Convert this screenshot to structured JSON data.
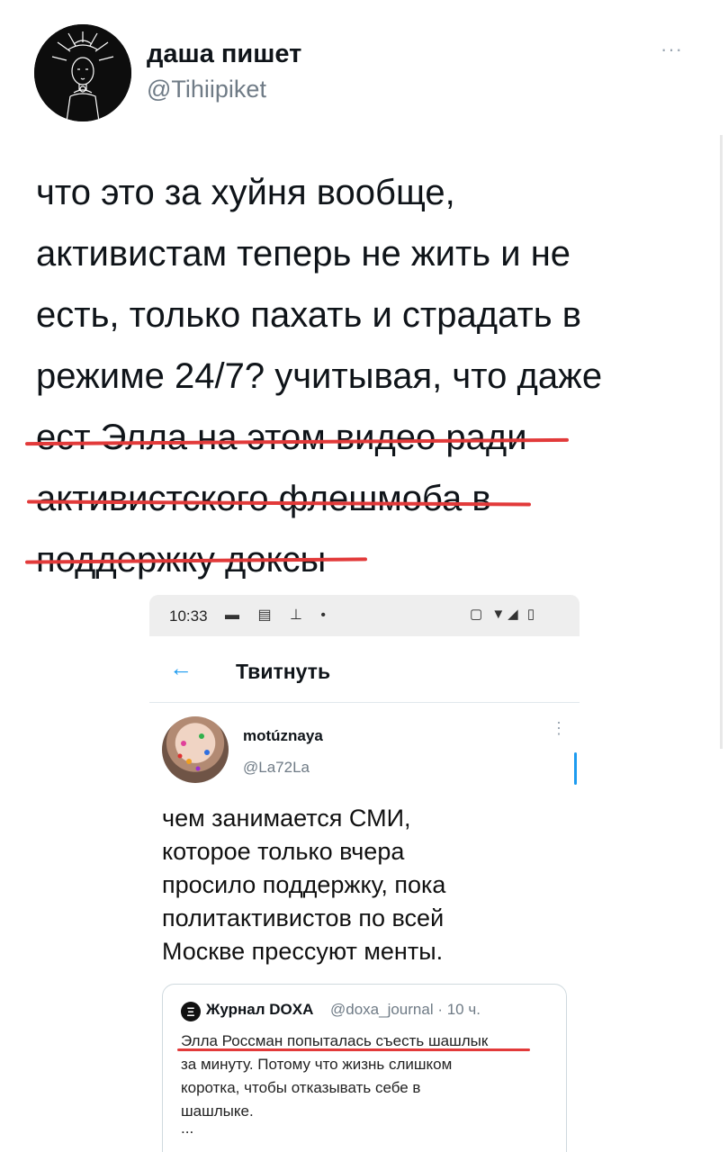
{
  "tweet": {
    "author_name": "даша пишет",
    "author_handle": "@Tihiipiket",
    "more_label": "···",
    "lines": [
      "что это за хуйня вообще,",
      "активистам теперь не жить и не",
      "есть, только пахать и страдать в",
      "режиме 24/7? учитывая, что даже",
      "ест Элла на этом видео ради",
      "активистского флешмоба в",
      "поддержку доксы"
    ],
    "highlight_color": "#e23a3a"
  },
  "embedded": {
    "status_bar": {
      "time": "10:33",
      "icons_left": "▬ ▤ ⊥ •",
      "icons_right": "▢ ▼◢ ▯"
    },
    "nav": {
      "back_icon": "←",
      "title": "Твитнуть"
    },
    "tweet": {
      "author_name": "motúznaya",
      "author_handle": "@La72La",
      "more_label": "⋮",
      "lines": [
        "чем занимается СМИ,",
        "которое только вчера",
        "просило поддержку, пока",
        "политактивистов по всей",
        "Москве прессуют менты."
      ]
    },
    "quote": {
      "logo": "Ξ",
      "name": "Журнал DOXA",
      "handle": "@doxa_journal · 10 ч.",
      "lines": [
        "Элла Россман попыталась съесть шашлык",
        "за минуту. Потому что жизнь слишком",
        "коротка, чтобы отказывать себе в",
        "шашлыке."
      ],
      "ellipsis": "..."
    }
  },
  "colors": {
    "accent": "#1d9bf0",
    "text": "#0f1419",
    "muted": "#6f7b86"
  }
}
